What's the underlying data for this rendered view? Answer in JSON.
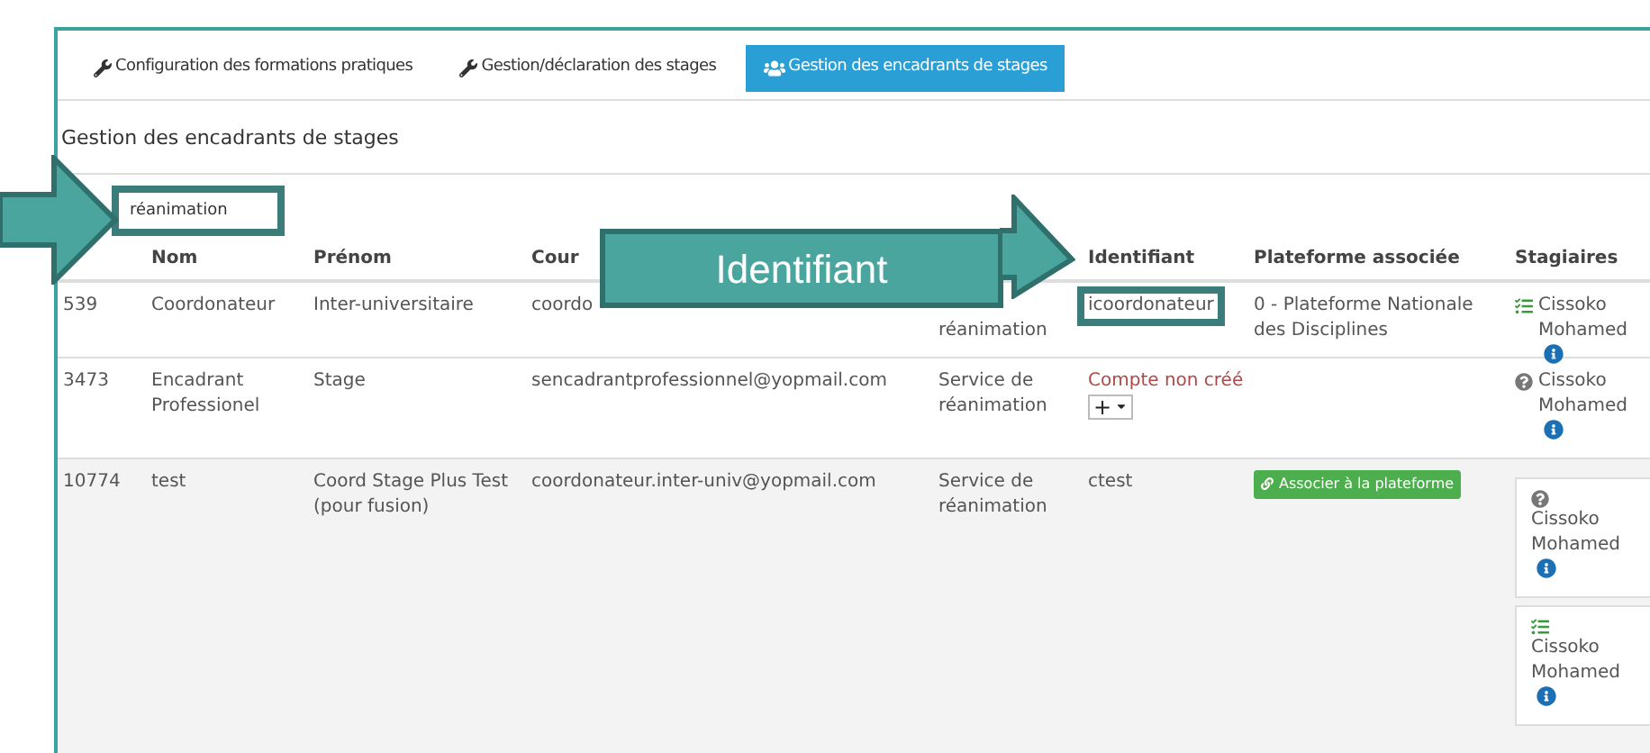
{
  "tabs": [
    {
      "label": "Configuration des formations pratiques",
      "selected": false
    },
    {
      "label": "Gestion/déclaration des stages",
      "selected": false
    },
    {
      "label": "Gestion des encadrants de stages",
      "selected": true
    }
  ],
  "heading": "Gestion des encadrants de stages",
  "search": {
    "value": "réanimation",
    "highlighted": true
  },
  "table": {
    "header": {
      "nom": "Nom",
      "prenom": "Prénom",
      "courriel": "Cour",
      "identifiant": "Identifiant",
      "plateforme": "Plateforme associée",
      "stagiaires": "Stagiaires"
    },
    "rows": [
      {
        "id": "539",
        "nom": "Coordonateur",
        "prenom": "Inter-universitaire",
        "courriel": "coordo",
        "service_tail": "réanimation",
        "identifiant": {
          "kind": "login",
          "text": "icoordonateur",
          "highlighted": true
        },
        "plateforme": {
          "kind": "text",
          "text": "0 - Plateforme Nationale des Disciplines"
        },
        "stagiaires": [
          {
            "kind": "checklist",
            "name": "Cissoko Mohamed"
          }
        ],
        "hovered": false
      },
      {
        "id": "3473",
        "nom": "Encadrant Professionel",
        "prenom": "Stage",
        "courriel": "sencadrantprofessionnel@yopmail.com",
        "service": "Service de réanimation",
        "identifiant": {
          "kind": "missing",
          "text": "Compte non créé",
          "add_label": "+"
        },
        "stagiaires": [
          {
            "kind": "unknown",
            "name": "Cissoko Mohamed"
          }
        ],
        "hovered": false
      },
      {
        "id": "10774",
        "nom": "test",
        "prenom": "Coord Stage Plus Test (pour fusion)",
        "courriel": "coordonateur.inter-univ@yopmail.com",
        "service": "Service de réanimation",
        "identifiant": {
          "kind": "login",
          "text": "ctest",
          "highlighted": false
        },
        "plateforme": {
          "kind": "button",
          "text": "Associer à la plateforme"
        },
        "stagiaires": [
          {
            "kind": "unknown",
            "name": "Cissoko Mohamed"
          },
          {
            "kind": "checklist",
            "name": "Cissoko Mohamed"
          }
        ],
        "hovered": true
      }
    ]
  },
  "callout": {
    "text": "Identifiant"
  }
}
